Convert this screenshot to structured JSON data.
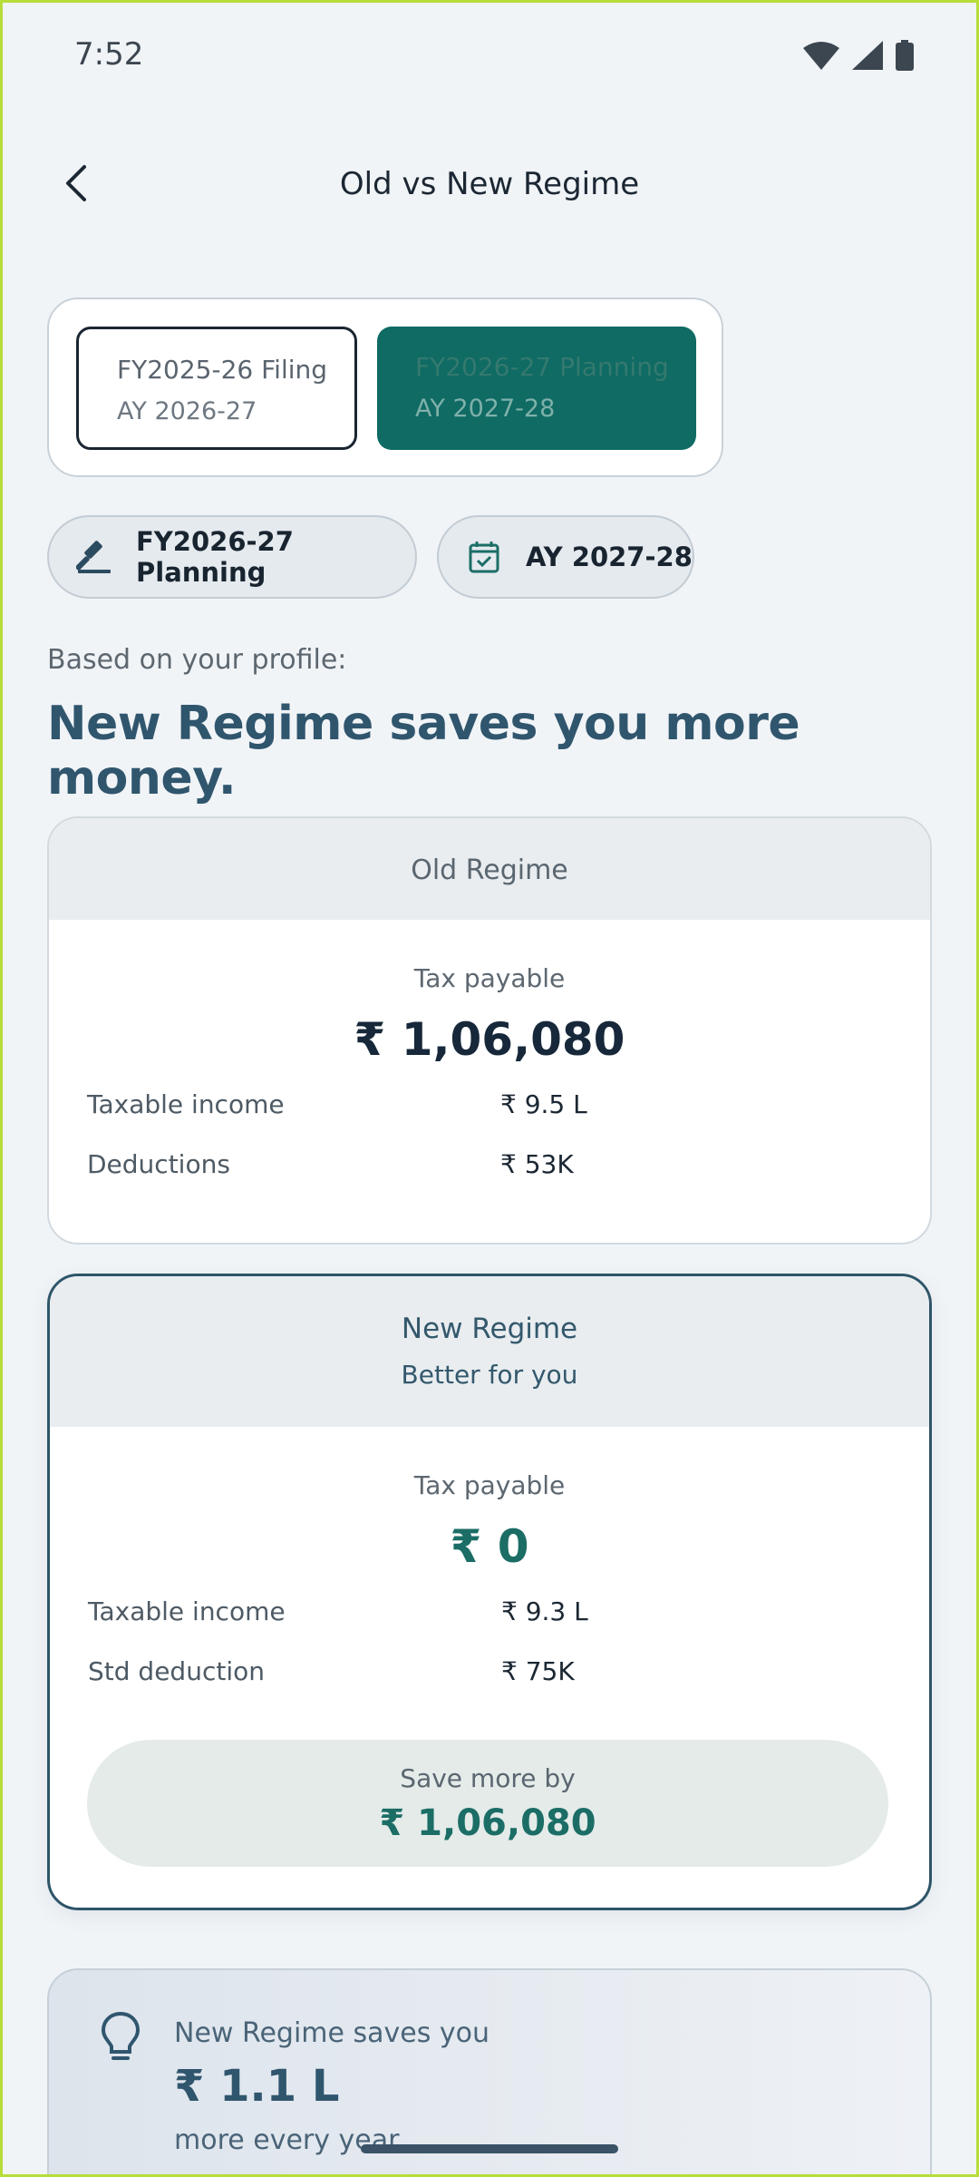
{
  "status_bar": {
    "time": "7:52"
  },
  "header": {
    "title": "Old vs New Regime"
  },
  "segment": {
    "options": [
      {
        "label": "FY2025-26 Filing",
        "sub": "AY 2026-27"
      },
      {
        "label": "FY2026-27 Planning",
        "sub": "AY 2027-28"
      }
    ]
  },
  "chips": [
    {
      "label": "FY2026-27 Planning",
      "icon": "gavel-icon"
    },
    {
      "label": "AY 2027-28",
      "icon": "calendar-check-icon"
    }
  ],
  "intro": {
    "label": "Based on your profile:",
    "headline": "New Regime saves you more money."
  },
  "old_regime": {
    "title": "Old Regime",
    "tax_label": "Tax payable",
    "tax_value": "₹ 1,06,080",
    "rows": [
      {
        "key": "Taxable income",
        "value": "₹ 9.5 L"
      },
      {
        "key": "Deductions",
        "value": "₹ 53K"
      }
    ]
  },
  "new_regime": {
    "title": "New Regime",
    "subtitle": "Better for you",
    "tax_label": "Tax payable",
    "tax_value": "₹ 0",
    "rows": [
      {
        "key": "Taxable income",
        "value": "₹ 9.3 L"
      },
      {
        "key": "Std deduction",
        "value": "₹ 75K"
      }
    ],
    "save_label": "Save more by",
    "save_value": "₹ 1,06,080"
  },
  "tip": {
    "line1": "New Regime saves you",
    "value": "₹ 1.1 L",
    "line2": "more every year."
  },
  "colors": {
    "primary": "#0f6b63",
    "heading": "#30566e",
    "background": "#f1f4f7"
  }
}
